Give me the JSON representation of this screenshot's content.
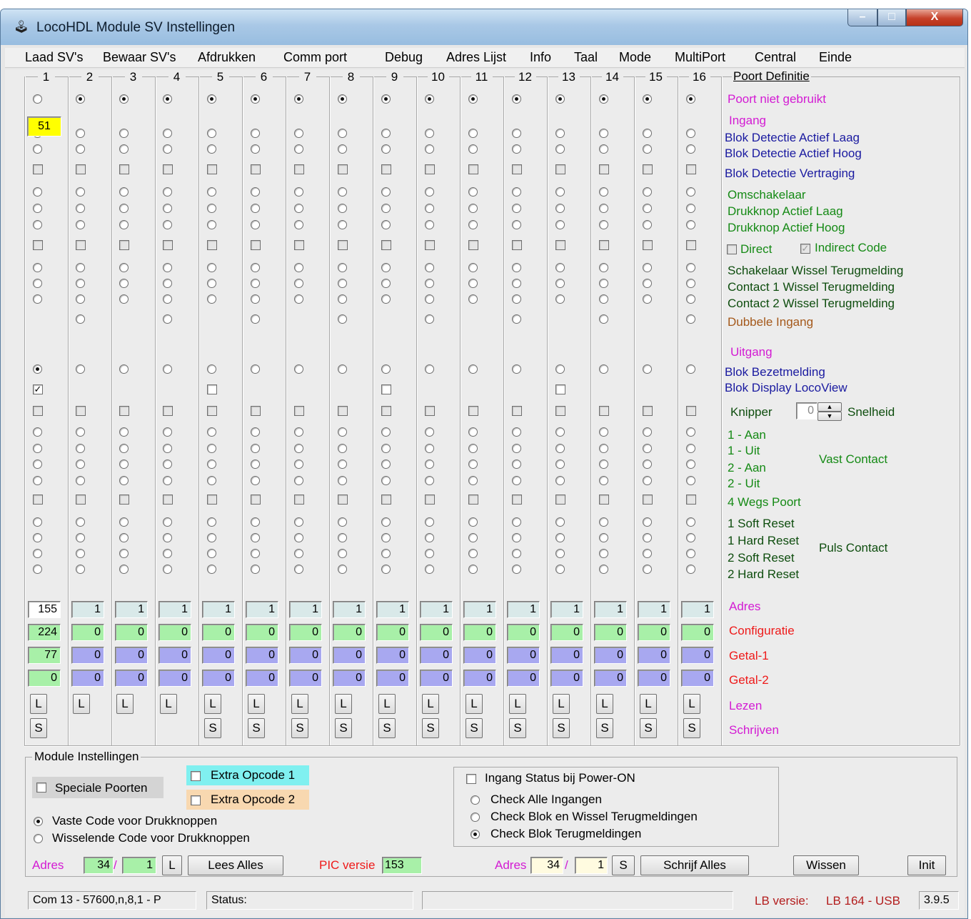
{
  "window": {
    "title": "LocoHDL Module SV Instellingen",
    "app_icon": "🕹",
    "min_glyph": "–",
    "max_glyph": "□",
    "close_glyph": "X"
  },
  "menu": [
    "Laad SV's",
    "Bewaar SV's",
    "Afdrukken",
    "Comm port",
    "Debug",
    "Adres Lijst",
    "Info",
    "Taal",
    "Mode",
    "MultiPort",
    "Central",
    "Einde"
  ],
  "columns": [
    "1",
    "2",
    "3",
    "4",
    "5",
    "6",
    "7",
    "8",
    "9",
    "10",
    "11",
    "12",
    "13",
    "14",
    "15",
    "16"
  ],
  "port1_badge": "51",
  "port_definitie": {
    "title": "Poort Definitie",
    "niet_gebruikt": "Poort niet gebruikt",
    "ingang": "Ingang",
    "blok_laag": "Blok Detectie Actief Laag",
    "blok_hoog": "Blok Detectie Actief Hoog",
    "blok_vertraging": "Blok Detectie Vertraging",
    "omschakelaar": "Omschakelaar",
    "druk_laag": "Drukknop Actief Laag",
    "druk_hoog": "Drukknop Actief Hoog",
    "direct": "Direct",
    "indirect": "Indirect Code",
    "schakelaar": "Schakelaar Wissel Terugmelding",
    "contact1": "Contact 1 Wissel Terugmelding",
    "contact2": "Contact 2 Wissel Terugmelding",
    "dubbele": "Dubbele Ingang",
    "uitgang": "Uitgang",
    "bezetmelding": "Blok Bezetmelding",
    "locoview": "Blok Display LocoView",
    "knipper": "Knipper",
    "snelheid_val": "0",
    "snelheid": "Snelheid",
    "aan1": "1 - Aan",
    "uit1": "1 - Uit",
    "aan2": "2 - Aan",
    "uit2": "2 - Uit",
    "vast": "Vast Contact",
    "wegs": "4 Wegs Poort",
    "soft1": "1 Soft Reset",
    "hard1": "1 Hard Reset",
    "soft2": "2 Soft Reset",
    "hard2": "2 Hard Reset",
    "puls": "Puls Contact",
    "adres": "Adres",
    "configuratie": "Configuratie",
    "getal1": "Getal-1",
    "getal2": "Getal-2",
    "lezen": "Lezen",
    "schrijven": "Schrijven"
  },
  "adres_values": [
    "155",
    "1",
    "1",
    "1",
    "1",
    "1",
    "1",
    "1",
    "1",
    "1",
    "1",
    "1",
    "1",
    "1",
    "1",
    "1"
  ],
  "config_values": [
    "224",
    "0",
    "0",
    "0",
    "0",
    "0",
    "0",
    "0",
    "0",
    "0",
    "0",
    "0",
    "0",
    "0",
    "0",
    "0"
  ],
  "getal1_values": [
    "77",
    "0",
    "0",
    "0",
    "0",
    "0",
    "0",
    "0",
    "0",
    "0",
    "0",
    "0",
    "0",
    "0",
    "0",
    "0"
  ],
  "getal2_values": [
    "0",
    "0",
    "0",
    "0",
    "0",
    "0",
    "0",
    "0",
    "0",
    "0",
    "0",
    "0",
    "0",
    "0",
    "0",
    "0"
  ],
  "btn_l": "L",
  "btn_s": "S",
  "module": {
    "title": "Module Instellingen",
    "speciale": "Speciale Poorten",
    "extra1": "Extra Opcode 1",
    "extra2": "Extra Opcode 2",
    "vaste": "Vaste Code voor Drukknoppen",
    "wisselende": "Wisselende Code voor Drukknoppen",
    "ingang_status": "Ingang Status bij Power-ON",
    "check_alle": "Check Alle Ingangen",
    "check_blok_wissel": "Check Blok en Wissel Terugmeldingen",
    "check_blok": "Check Blok Terugmeldingen",
    "adres_label": "Adres",
    "adres1": "34",
    "adres2": "1",
    "slash": "/",
    "lees_alles": "Lees Alles",
    "pic_label": "PIC versie",
    "pic_val": "153",
    "adres_w1": "34",
    "adres_w2": "1",
    "schrijf_alles": "Schrijf Alles",
    "wissen": "Wissen",
    "init": "Init"
  },
  "status": {
    "comm": "Com 13 - 57600,n,8,1 - P",
    "status": "Status:",
    "lb_label": "LB versie:",
    "lb_val": "LB 164 - USB",
    "version": "3.9.5"
  },
  "colors": {
    "field_green": "#a8f0a8",
    "field_blue": "#a8a8f0",
    "field_gray": "#d9e9e9",
    "badge_yellow": "#ffff00",
    "extra1": "#80f0f0",
    "extra2": "#f8d8b0"
  }
}
